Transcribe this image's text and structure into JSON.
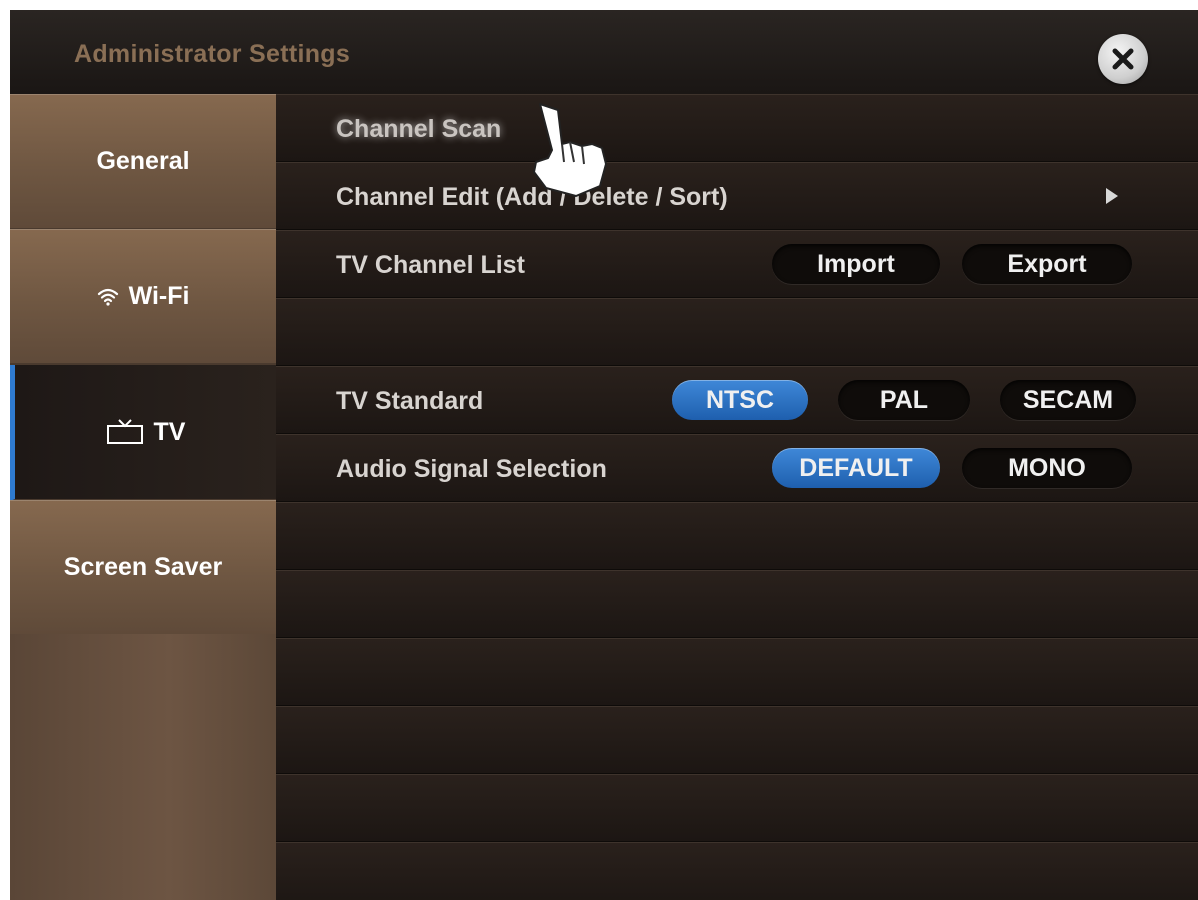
{
  "window": {
    "title": "Administrator Settings"
  },
  "sidebar": {
    "items": [
      {
        "label": "General",
        "icon": ""
      },
      {
        "label": "Wi-Fi",
        "icon": "wifi-icon"
      },
      {
        "label": "TV",
        "icon": "tv-icon",
        "active": true
      },
      {
        "label": "Screen Saver",
        "icon": ""
      }
    ]
  },
  "content": {
    "channel_scan": {
      "label": "Channel Scan"
    },
    "channel_edit": {
      "label": "Channel  Edit (Add / Delete / Sort)"
    },
    "channel_list": {
      "label": "TV Channel List",
      "import_label": "Import",
      "export_label": "Export"
    },
    "tv_standard": {
      "label": "TV Standard",
      "options": [
        "NTSC",
        "PAL",
        "SECAM"
      ],
      "selected": "NTSC"
    },
    "audio_signal": {
      "label": "Audio Signal Selection",
      "options": [
        "DEFAULT",
        "MONO"
      ],
      "selected": "DEFAULT"
    }
  },
  "colors": {
    "accent": "#2f7bd0",
    "sidebar": "#735a45",
    "background": "#161210"
  }
}
